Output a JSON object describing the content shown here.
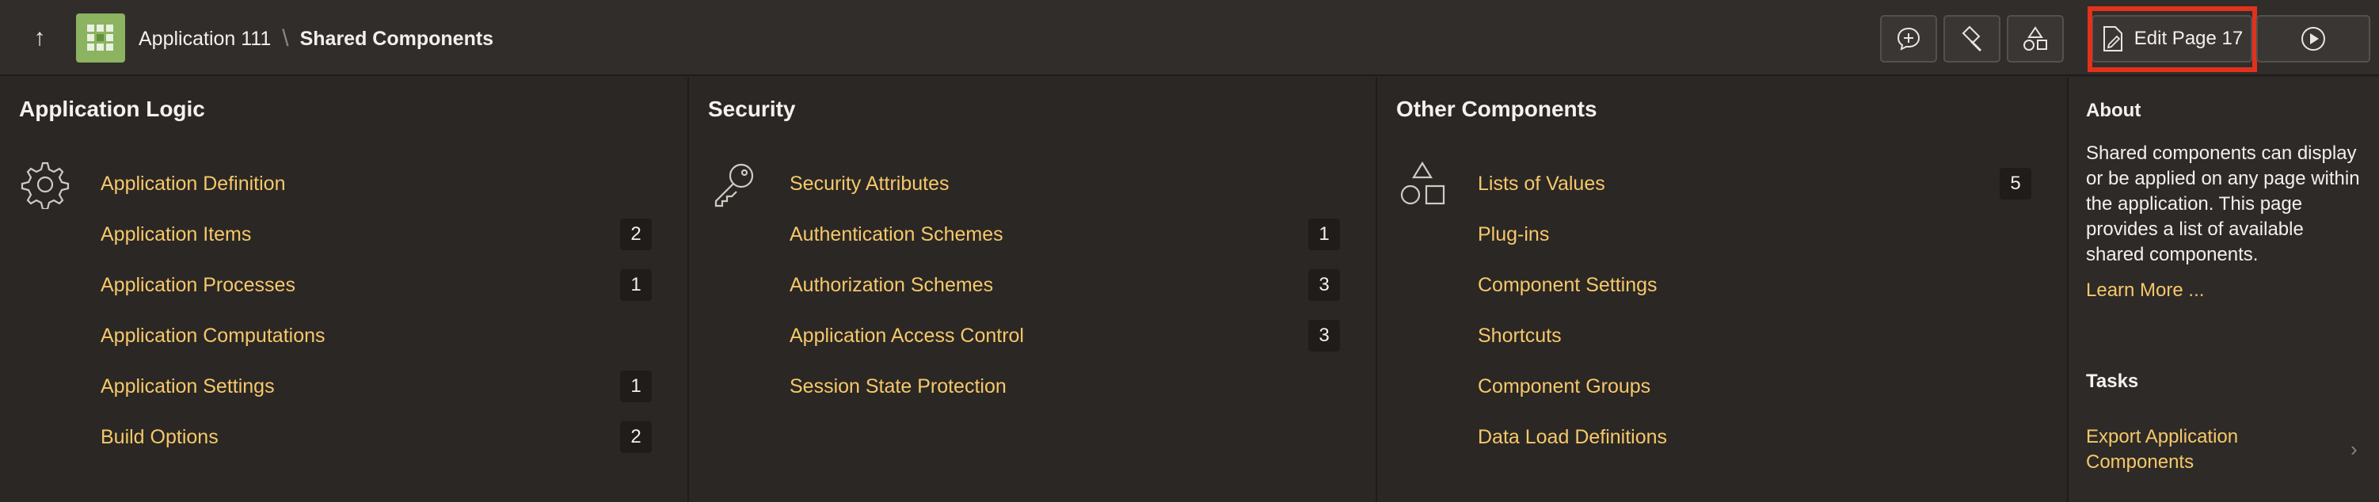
{
  "header": {
    "app_name": "Application 111",
    "separator": "\\",
    "current_page": "Shared Components",
    "edit_label": "Edit Page 17"
  },
  "panels": [
    {
      "title": "Application Logic",
      "icon": "gear-icon",
      "items": [
        {
          "label": "Application Definition",
          "count": ""
        },
        {
          "label": "Application Items",
          "count": "2"
        },
        {
          "label": "Application Processes",
          "count": "1"
        },
        {
          "label": "Application Computations",
          "count": ""
        },
        {
          "label": "Application Settings",
          "count": "1"
        },
        {
          "label": "Build Options",
          "count": "2"
        }
      ]
    },
    {
      "title": "Security",
      "icon": "key-icon",
      "items": [
        {
          "label": "Security Attributes",
          "count": ""
        },
        {
          "label": "Authentication Schemes",
          "count": "1"
        },
        {
          "label": "Authorization Schemes",
          "count": "3"
        },
        {
          "label": "Application Access Control",
          "count": "3"
        },
        {
          "label": "Session State Protection",
          "count": ""
        }
      ]
    },
    {
      "title": "Other Components",
      "icon": "shapes-icon",
      "items": [
        {
          "label": "Lists of Values",
          "count": "5"
        },
        {
          "label": "Plug-ins",
          "count": ""
        },
        {
          "label": "Component Settings",
          "count": ""
        },
        {
          "label": "Shortcuts",
          "count": ""
        },
        {
          "label": "Component Groups",
          "count": ""
        },
        {
          "label": "Data Load Definitions",
          "count": ""
        }
      ]
    }
  ],
  "about": {
    "title": "About",
    "text": "Shared components can display or be applied on any page within the application. This page provides a list of available shared components.",
    "learn_more": "Learn More ..."
  },
  "tasks": {
    "title": "Tasks",
    "items": [
      "Export Application Components"
    ]
  }
}
